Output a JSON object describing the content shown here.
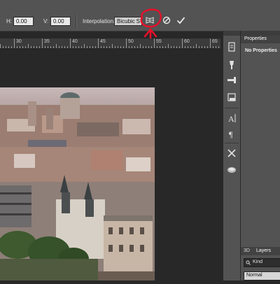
{
  "options_bar": {
    "h_label": "H:",
    "h_value": "0.00",
    "v_label": "V:",
    "v_value": "0.00",
    "interpolation_label": "Interpolation:",
    "interpolation_value": "Bicubic",
    "interpolation_extra": "S"
  },
  "ruler": {
    "labels": [
      "30",
      "35",
      "40",
      "45",
      "50",
      "55",
      "60",
      "65"
    ]
  },
  "panels": {
    "properties_tab": "Properties",
    "properties_message": "No Properties",
    "layers_tabs": [
      "3D",
      "Layers"
    ],
    "kind_filter": "Kind",
    "blend_mode": "Normal"
  },
  "colors": {
    "annotation": "#e8102a",
    "ui_dark": "#282828",
    "ui_mid": "#535353"
  },
  "icons": [
    "warp-mode-icon",
    "cancel-transform-icon",
    "commit-transform-icon"
  ]
}
